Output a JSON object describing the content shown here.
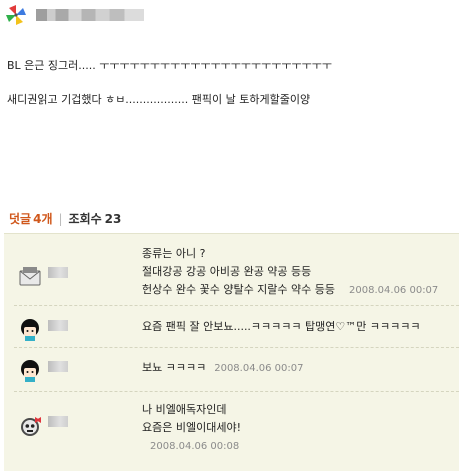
{
  "post": {
    "line1": "BL 은근 징그러..... ㅜㅜㅜㅜㅜㅜㅜㅜㅜㅜㅜㅜㅜㅜㅜㅜㅜㅜㅜㅜㅜㅜㅜ",
    "line2": "새디권읽고 기겁했다 ㅎㅂ.................. 팬픽이 날 토하게할줄이양"
  },
  "stats": {
    "comments_label": "덧글",
    "comments_count": "4개",
    "views_label": "조회수",
    "views_count": "23"
  },
  "comments": [
    {
      "lines": [
        "종류는 아니 ?",
        "절대강공 강공 아비공 완공 약공 등등",
        "헌상수 완수 꽃수 양탈수 지랄수 약수 등등"
      ],
      "date": "2008.04.06 00:07"
    },
    {
      "lines": [
        "요즘 팬픽 잘 안보뇨.....ㅋㅋㅋㅋㅋ 탑맹연♡™만 ㅋㅋㅋㅋㅋ"
      ],
      "date": ""
    },
    {
      "lines": [
        "보뇨 ㅋㅋㅋㅋ"
      ],
      "date": "2008.04.06 00:07"
    },
    {
      "lines": [
        "나 비엘애독자인데",
        "요즘은 비엘이대세야!"
      ],
      "date": "2008.04.06 00:08"
    }
  ],
  "icons": {
    "post_author": "pinwheel-icon",
    "avatar1": "envelope-avatar-icon",
    "avatar2": "black-hair-character-avatar-icon",
    "avatar3": "black-hair-character-avatar-icon",
    "avatar4": "skull-bow-avatar-icon"
  },
  "colors": {
    "accent": "#d0571b",
    "comment_bg": "#f5f5e6",
    "date": "#8b8b8b"
  }
}
